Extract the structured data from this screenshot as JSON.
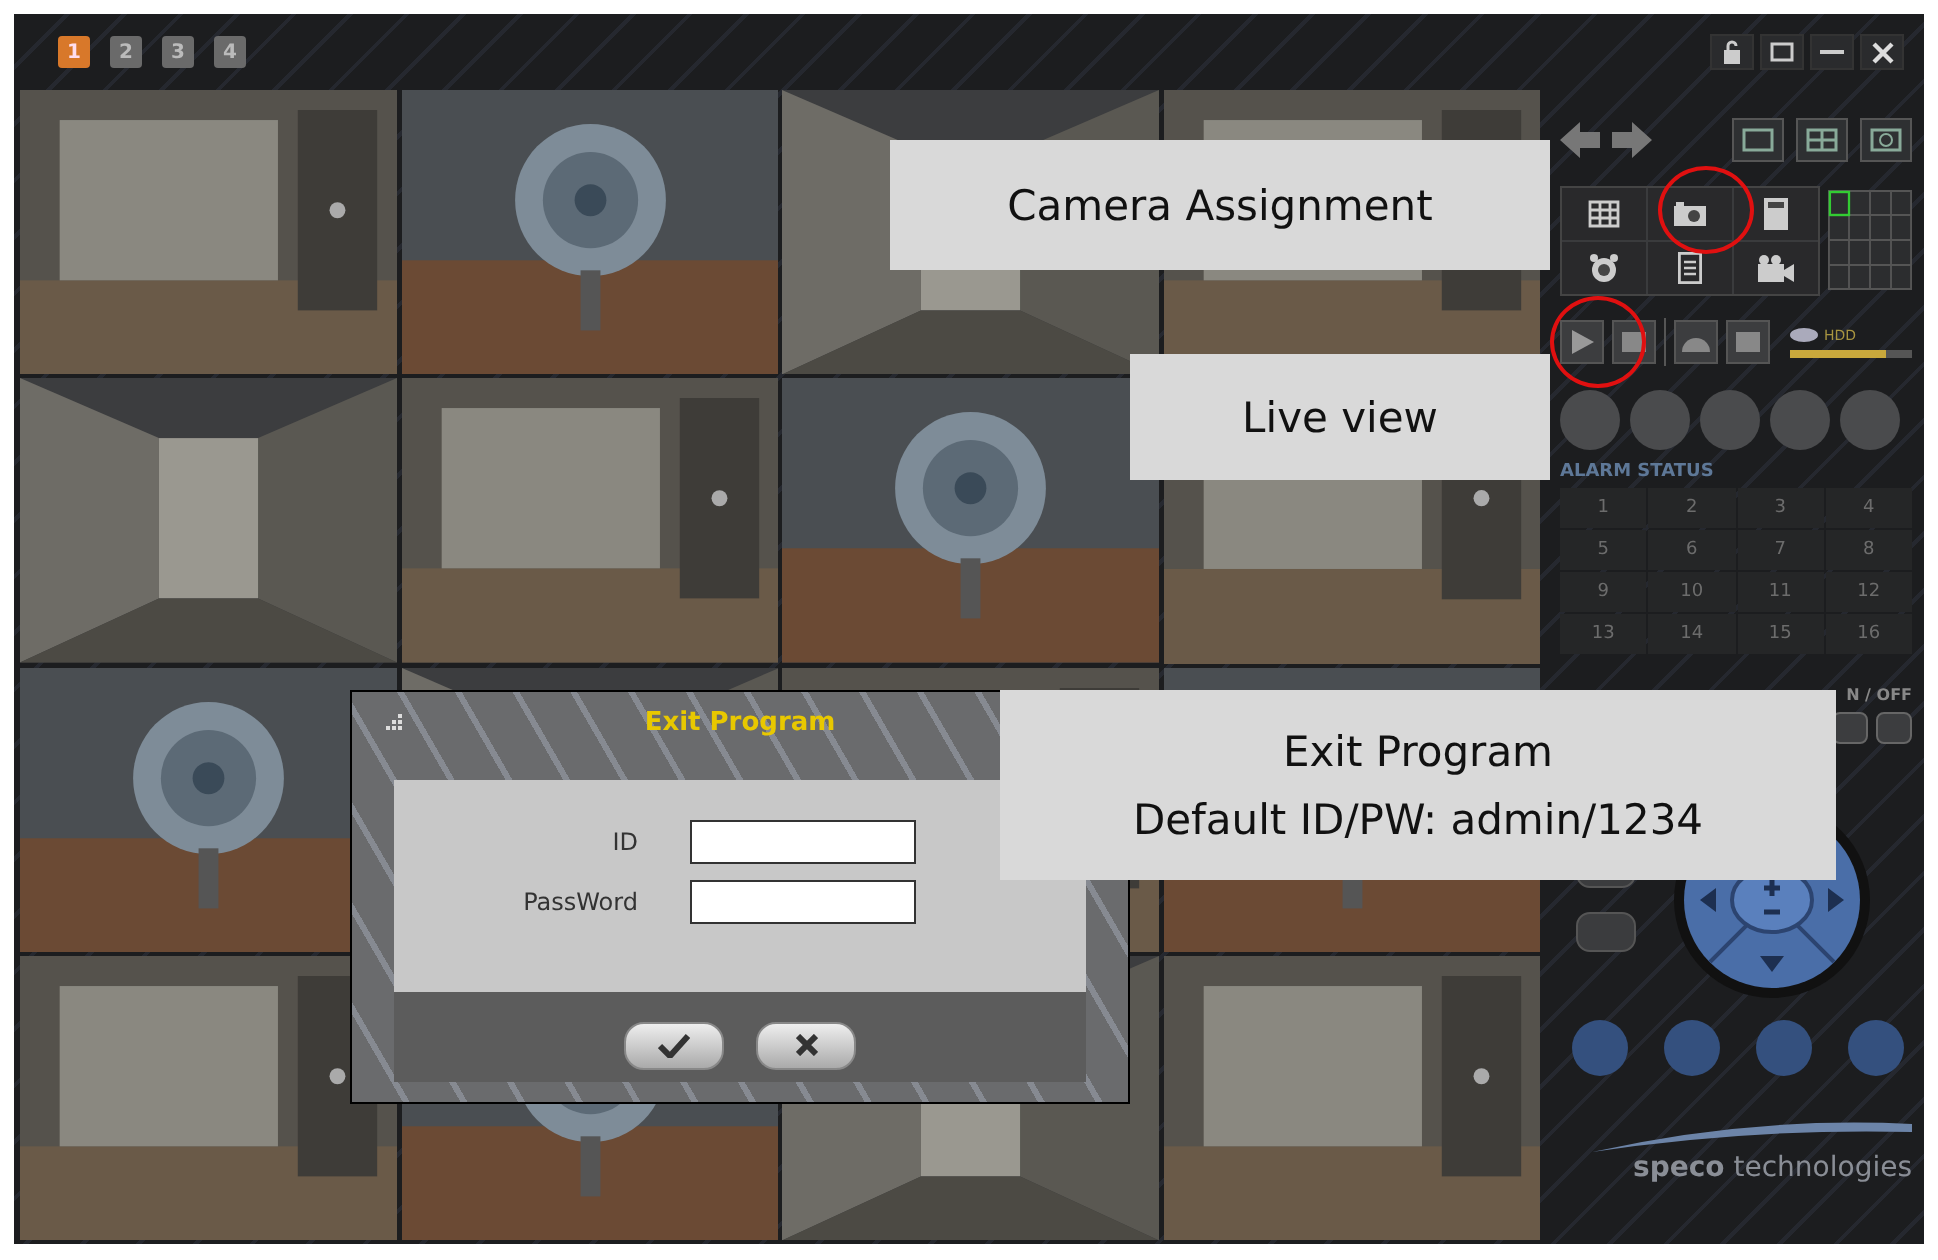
{
  "page_tabs": [
    {
      "label": "1",
      "selected": true
    },
    {
      "label": "2",
      "selected": false
    },
    {
      "label": "3",
      "selected": false
    },
    {
      "label": "4",
      "selected": false
    }
  ],
  "hdd": {
    "label": "HDD",
    "level": 0.78
  },
  "alarm_status": {
    "title": "ALARM STATUS",
    "channels": [
      "1",
      "2",
      "3",
      "4",
      "5",
      "6",
      "7",
      "8",
      "9",
      "10",
      "11",
      "12",
      "13",
      "14",
      "15",
      "16"
    ]
  },
  "on_off_label": "N / OFF",
  "brand": "**speco** technologies",
  "dialog": {
    "title": "Exit Program",
    "fields": [
      {
        "label": "ID"
      },
      {
        "label": "PassWord"
      }
    ],
    "buttons": [
      {
        "kind": "ok"
      },
      {
        "kind": "cancel"
      }
    ]
  },
  "callouts": [
    {
      "lines": [
        "Camera Assignment"
      ]
    },
    {
      "lines": [
        "Live view"
      ]
    },
    {
      "lines": [
        "Exit Program",
        "Default ID/PW: admin/1234"
      ]
    }
  ]
}
